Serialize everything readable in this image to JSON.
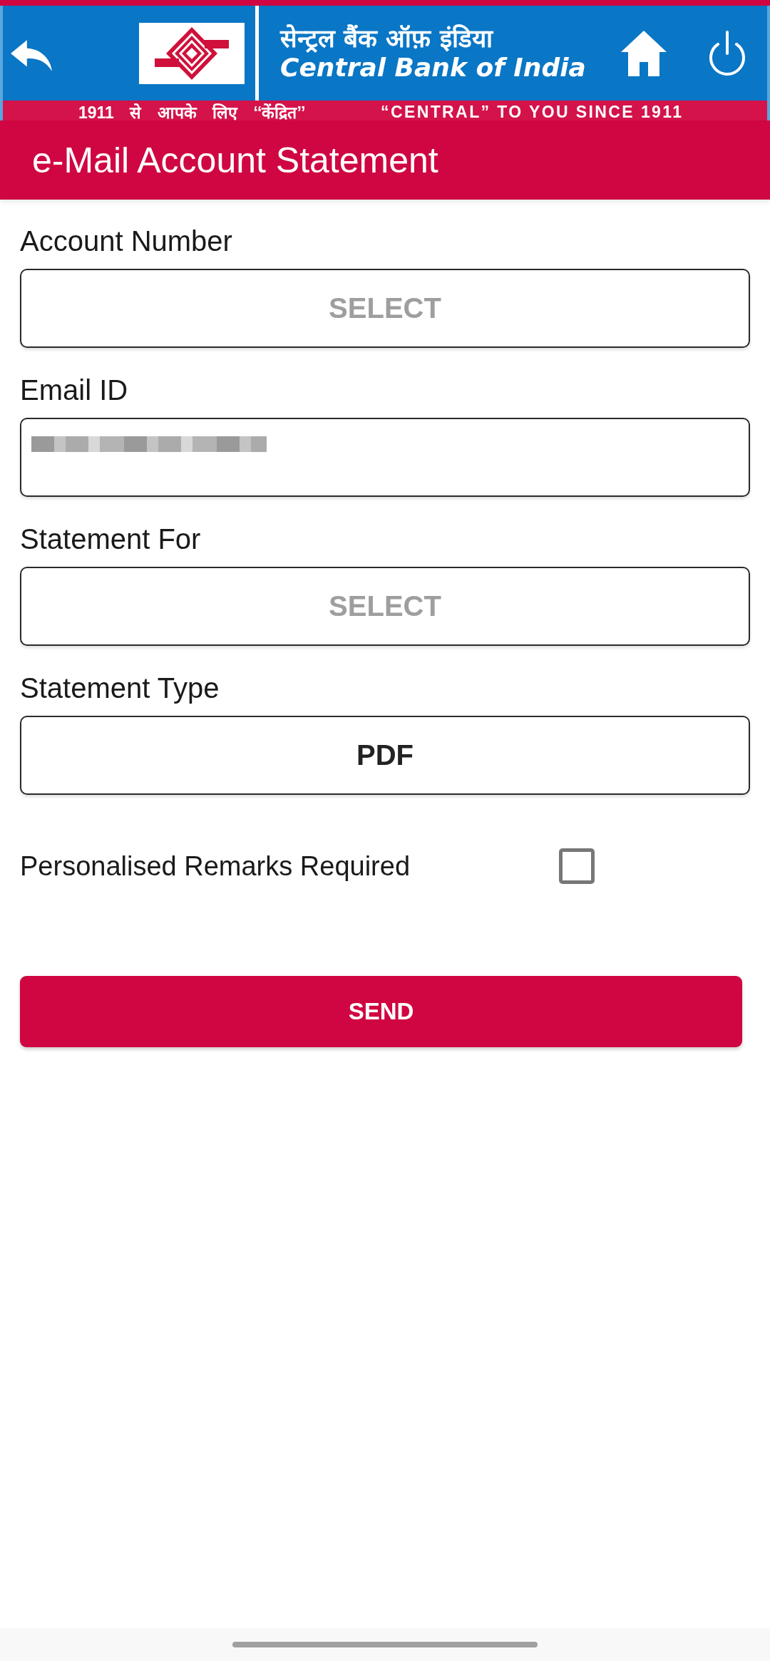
{
  "header": {
    "hindi_name": "सेन्ट्रल बैंक ऑफ़ इंडिया",
    "english_name": "Central Bank of India",
    "tagline": [
      "1911 से आपके लिए ‘‘केंद्रित’’",
      "“CENTRAL” TO YOU SINCE 1911"
    ]
  },
  "title_bar": {
    "title": "e-Mail Account Statement"
  },
  "fields": [
    {
      "label": "Account Number",
      "kind": "select",
      "placeholder": "SELECT"
    },
    {
      "label": "Email ID",
      "kind": "text",
      "redacted": true
    },
    {
      "label": "Statement For",
      "kind": "select",
      "placeholder": "SELECT"
    },
    {
      "label": "Statement Type",
      "kind": "select",
      "value": "PDF"
    }
  ],
  "remarks": {
    "label": "Personalised Remarks Required",
    "checked": false
  },
  "send_button": {
    "label": "SEND"
  }
}
